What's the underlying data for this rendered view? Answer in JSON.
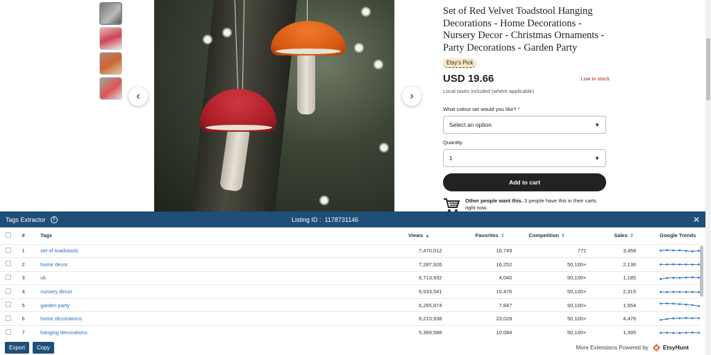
{
  "product": {
    "title": "Set of Red Velvet Toadstool Hanging Decorations - Home Decorations - Nursery Decor - Christmas Ornaments - Party Decorations - Garden Party",
    "badge": "Etsy's Pick",
    "price": "USD 19.66",
    "stock": "Low in stock",
    "tax_note": "Local taxes included (where applicable)",
    "colour_label": "What colour set would you like?",
    "required_mark": "*",
    "colour_value": "Select an option",
    "quantity_label": "Quantity",
    "quantity_value": "1",
    "add_to_cart": "Add to cart",
    "want_bold": "Other people want this.",
    "want_rest": " 3 people have this in their carts right now."
  },
  "gallery": {
    "prev_icon": "chevron-left-icon",
    "next_icon": "chevron-right-icon"
  },
  "extractor": {
    "title": "Tags Extractor",
    "help_icon": "?",
    "listing_label": "Listing ID :",
    "listing_id": "1178731146",
    "close_icon": "✕",
    "columns": {
      "num": "#",
      "tags": "Tags",
      "views": "Views",
      "favorites": "Favorites",
      "competition": "Competition",
      "sales": "Sales",
      "trends": "Google Trends"
    },
    "rows": [
      {
        "num": "1",
        "tag": "set of toadstools",
        "views": "7,470,012",
        "favorites": "16,749",
        "competition": "772",
        "sales": "3,458",
        "trend": [
          5,
          5.5,
          5,
          5.2,
          4.6,
          4.2,
          4.8
        ]
      },
      {
        "num": "2",
        "tag": "home decor",
        "views": "7,287,926",
        "favorites": "16,252",
        "competition": "50,100+",
        "sales": "2,136",
        "trend": [
          4.2,
          4.2,
          4.3,
          4.2,
          4.2,
          4.1,
          4.2
        ]
      },
      {
        "num": "3",
        "tag": "uk",
        "views": "6,713,932",
        "favorites": "4,040",
        "competition": "50,100+",
        "sales": "1,185",
        "trend": [
          3.5,
          4.5,
          4.8,
          4.6,
          5,
          5.2,
          4.8
        ]
      },
      {
        "num": "4",
        "tag": "nursery decor",
        "views": "6,533,541",
        "favorites": "10,476",
        "competition": "50,100+",
        "sales": "2,315",
        "trend": [
          4.5,
          4.3,
          4.6,
          4.5,
          4.4,
          4.5,
          4.2
        ]
      },
      {
        "num": "5",
        "tag": "garden party",
        "views": "6,265,874",
        "favorites": "7,847",
        "competition": "50,100+",
        "sales": "1,554",
        "trend": [
          6,
          6.2,
          6,
          5.5,
          5,
          4.5,
          3.5
        ]
      },
      {
        "num": "6",
        "tag": "home decorations",
        "views": "6,210,938",
        "favorites": "23,028",
        "competition": "50,100+",
        "sales": "4,476",
        "trend": [
          3.5,
          4.5,
          5,
          5.2,
          5.5,
          5.3,
          5.2
        ]
      },
      {
        "num": "7",
        "tag": "hanging decorations",
        "views": "5,369,588",
        "favorites": "10,084",
        "competition": "50,100+",
        "sales": "1,395",
        "trend": [
          4.5,
          4.7,
          4.4,
          4.3,
          4.6,
          4.8,
          4.6
        ]
      }
    ],
    "trend_color": "#2e74c9"
  },
  "footer": {
    "export": "Export",
    "copy": "Copy",
    "powered": "More Extensions Powered by",
    "brand": "EtsyHunt"
  },
  "colors": {
    "panel_header": "#1f4e79",
    "link": "#2a6fbd",
    "stock_red": "#b31b1b"
  }
}
